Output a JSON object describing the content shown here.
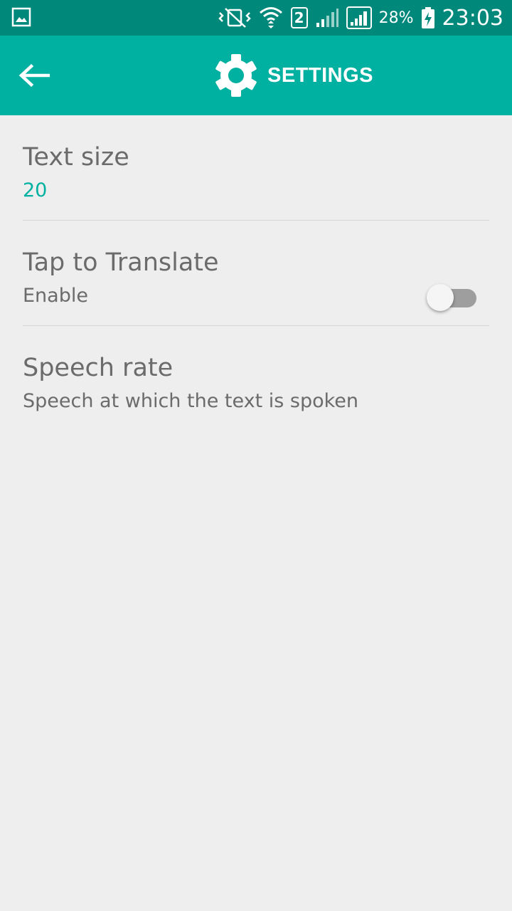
{
  "status_bar": {
    "battery_percent": "28%",
    "time": "23:03",
    "sim_slot": "2",
    "icons": [
      "gallery-icon",
      "vibrate-icon",
      "wifi-icon",
      "sim-icon",
      "signal-icon",
      "signal-icon",
      "battery-charging-icon"
    ]
  },
  "toolbar": {
    "title": "SETTINGS",
    "back_icon": "arrow-left-icon",
    "title_icon": "gear-icon"
  },
  "settings": {
    "text_size": {
      "title": "Text size",
      "value": "20"
    },
    "tap_to_translate": {
      "title": "Tap to Translate",
      "summary": "Enable",
      "enabled": false
    },
    "speech_rate": {
      "title": "Speech rate",
      "summary": "Speech at which the text is spoken"
    }
  },
  "colors": {
    "status_bar": "#00897b",
    "toolbar": "#00b0a0",
    "accent": "#00b0a0",
    "background": "#eeeeee",
    "text": "#6b6b6b"
  }
}
